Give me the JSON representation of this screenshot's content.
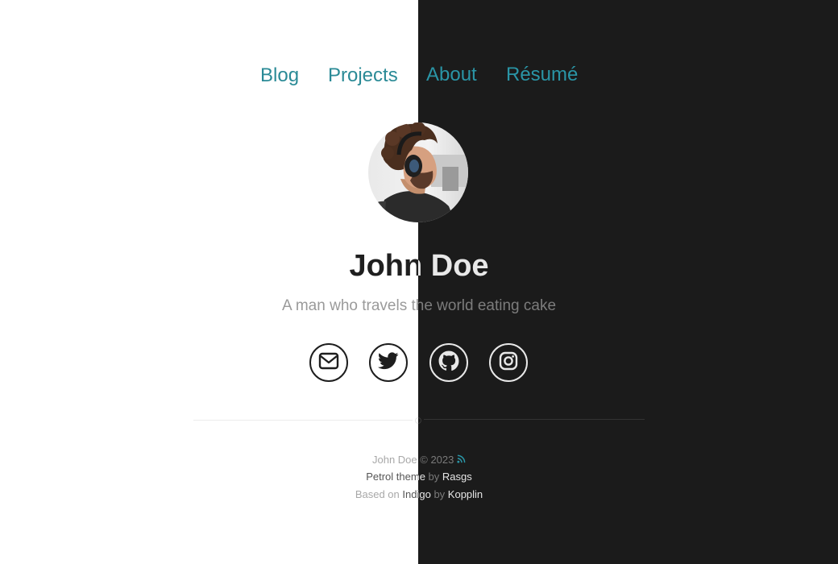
{
  "nav": {
    "items": [
      {
        "label": "Blog"
      },
      {
        "label": "Projects"
      },
      {
        "label": "About"
      },
      {
        "label": "Résumé"
      }
    ]
  },
  "profile": {
    "name": "John Doe",
    "tagline": "A man who travels the world eating cake"
  },
  "social": [
    {
      "icon": "envelope-icon",
      "label": "Email"
    },
    {
      "icon": "twitter-icon",
      "label": "Twitter"
    },
    {
      "icon": "github-icon",
      "label": "GitHub"
    },
    {
      "icon": "instagram-icon",
      "label": "Instagram"
    }
  ],
  "footer": {
    "copyright_name": "John Doe",
    "copyright_text": "© 2023",
    "theme_name": "Petrol theme",
    "by1": "by",
    "theme_author": "Rasgs",
    "based_on": "Based on",
    "base_theme": "Indigo",
    "by2": "by",
    "base_author": "Kopplin"
  },
  "colors": {
    "accent": "#2a8a96",
    "dark_bg": "#1b1b1b",
    "light_bg": "#ffffff"
  }
}
